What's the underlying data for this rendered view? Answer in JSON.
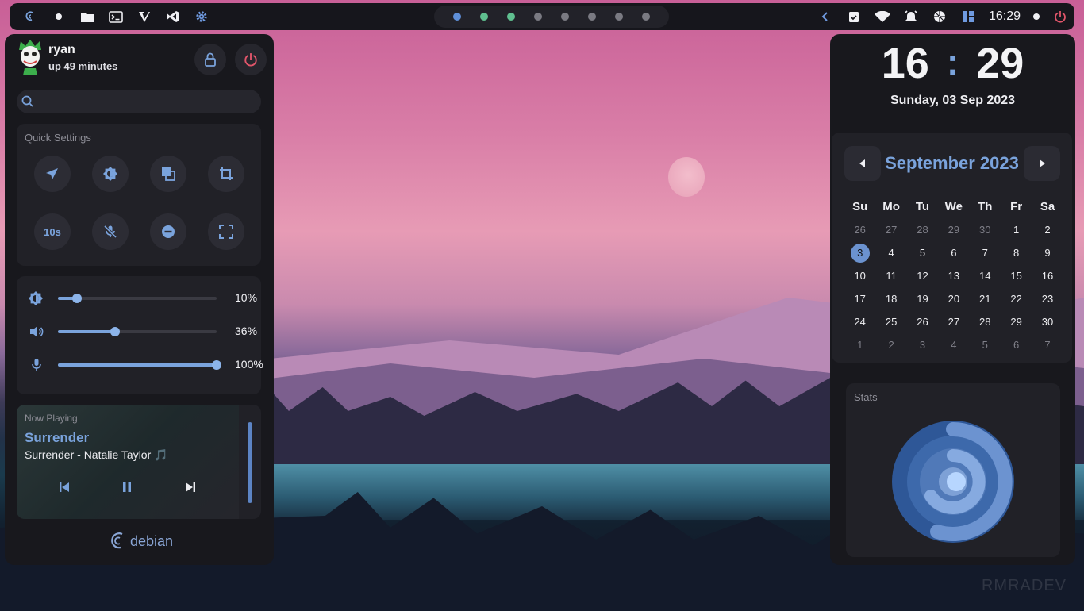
{
  "topbar": {
    "left_icons": [
      "debian-logo-icon",
      "dot-icon",
      "folder-icon",
      "terminal-icon",
      "vim-icon",
      "vscode-icon",
      "gear-icon"
    ],
    "workspaces": [
      {
        "color": "#5f8fd8",
        "active": true
      },
      {
        "color": "#5fbf8f",
        "active": false
      },
      {
        "color": "#5fbf8f",
        "active": false
      },
      {
        "color": "#7a7a82",
        "active": false
      },
      {
        "color": "#7a7a82",
        "active": false
      },
      {
        "color": "#7a7a82",
        "active": false
      },
      {
        "color": "#7a7a82",
        "active": false
      },
      {
        "color": "#7a7a82",
        "active": false
      }
    ],
    "right_icons": [
      "chevron-left-icon",
      "clipboard-check-icon",
      "wifi-icon",
      "alarm-icon",
      "shutter-icon",
      "layout-icon"
    ],
    "time": "16:29"
  },
  "user": {
    "name": "ryan",
    "uptime": "up 49 minutes"
  },
  "quick_settings": {
    "title": "Quick Settings",
    "buttons": [
      "airplane-icon",
      "brightness-icon",
      "screenshot-window-icon",
      "crop-icon",
      "timer-10s-icon",
      "mic-off-icon",
      "do-not-disturb-icon",
      "fullscreen-icon"
    ]
  },
  "sliders": [
    {
      "name": "brightness",
      "icon": "brightness-icon",
      "value": 10,
      "label": "10%"
    },
    {
      "name": "volume",
      "icon": "volume-icon",
      "value": 36,
      "label": "36%"
    },
    {
      "name": "microphone",
      "icon": "microphone-icon",
      "value": 100,
      "label": "100%"
    }
  ],
  "now_playing": {
    "label": "Now Playing",
    "title": "Surrender",
    "subtitle": "Surrender - Natalie Taylor 🎵"
  },
  "branding": {
    "distro": "debian"
  },
  "clock": {
    "hour": "16",
    "minute": "29",
    "separator": ":",
    "date": "Sunday, 03 Sep 2023"
  },
  "calendar": {
    "month": "September 2023",
    "weekdays": [
      "Su",
      "Mo",
      "Tu",
      "We",
      "Th",
      "Fr",
      "Sa"
    ],
    "days": [
      {
        "d": "26",
        "other": true
      },
      {
        "d": "27",
        "other": true
      },
      {
        "d": "28",
        "other": true
      },
      {
        "d": "29",
        "other": true
      },
      {
        "d": "30",
        "other": true
      },
      {
        "d": "1"
      },
      {
        "d": "2"
      },
      {
        "d": "3",
        "today": true
      },
      {
        "d": "4"
      },
      {
        "d": "5"
      },
      {
        "d": "6"
      },
      {
        "d": "7"
      },
      {
        "d": "8"
      },
      {
        "d": "9"
      },
      {
        "d": "10"
      },
      {
        "d": "11"
      },
      {
        "d": "12"
      },
      {
        "d": "13"
      },
      {
        "d": "14"
      },
      {
        "d": "15"
      },
      {
        "d": "16"
      },
      {
        "d": "17"
      },
      {
        "d": "18"
      },
      {
        "d": "19"
      },
      {
        "d": "20"
      },
      {
        "d": "21"
      },
      {
        "d": "22"
      },
      {
        "d": "23"
      },
      {
        "d": "24"
      },
      {
        "d": "25"
      },
      {
        "d": "26"
      },
      {
        "d": "27"
      },
      {
        "d": "28"
      },
      {
        "d": "29"
      },
      {
        "d": "30"
      },
      {
        "d": "1",
        "other": true
      },
      {
        "d": "2",
        "other": true
      },
      {
        "d": "3",
        "other": true
      },
      {
        "d": "4",
        "other": true
      },
      {
        "d": "5",
        "other": true
      },
      {
        "d": "6",
        "other": true
      },
      {
        "d": "7",
        "other": true
      }
    ]
  },
  "stats": {
    "title": "Stats"
  },
  "watermark": "RMRADEV",
  "colors": {
    "accent": "#7aa3dc",
    "panel": "#18181d",
    "card": "#212127",
    "power": "#e0556a"
  }
}
